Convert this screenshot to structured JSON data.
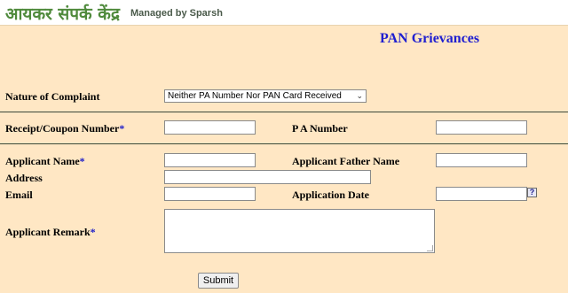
{
  "header": {
    "logo_hindi": "आयकर संपर्क केंद्र",
    "managed_by": "Managed by Sparsh"
  },
  "page_title": "PAN Grievances",
  "form": {
    "nature_label": "Nature of Complaint",
    "nature_selected": "Neither PA Number Nor PAN Card Received",
    "receipt_label": "Receipt/Coupon Number",
    "receipt_value": "",
    "pa_number_label": "P A Number",
    "pa_number_value": "",
    "applicant_name_label": "Applicant Name",
    "applicant_name_value": "",
    "father_name_label": "Applicant Father Name",
    "father_name_value": "",
    "address_label": "Address",
    "address_value": "",
    "email_label": "Email",
    "email_value": "",
    "app_date_label": "Application Date",
    "app_date_value": "",
    "help_glyph": "?",
    "remark_label": "Applicant Remark",
    "remark_value": "",
    "required_mark": "*",
    "submit_label": "Submit"
  },
  "colors": {
    "background": "#ffe7c4",
    "title": "#1f1fd0",
    "logo": "#4f8a3c",
    "required": "#1e1ec8"
  }
}
